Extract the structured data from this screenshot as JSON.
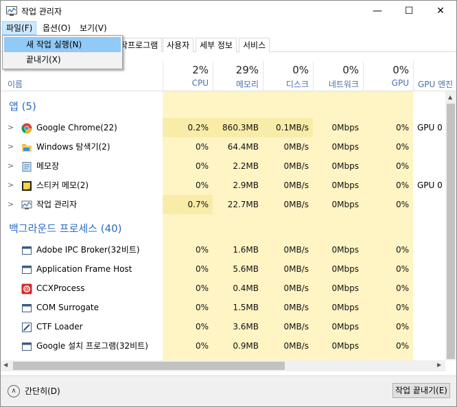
{
  "window": {
    "title": "작업 관리자",
    "controls": {
      "minimize": "—",
      "maximize": "☐",
      "close": "✕"
    }
  },
  "menubar": {
    "file": "파일(F)",
    "options": "옵션(O)",
    "view": "보기(V)"
  },
  "file_menu": {
    "items": [
      "새 작업 실행(N)",
      "끝내기(X)"
    ],
    "highlighted_index": 0
  },
  "tabs": [
    "작프로그램",
    "사용자",
    "세부 정보",
    "서비스"
  ],
  "header": {
    "name": "이름",
    "cpu": {
      "pct": "2%",
      "label": "CPU"
    },
    "mem": {
      "pct": "29%",
      "label": "메모리"
    },
    "disk": {
      "pct": "0%",
      "label": "디스크"
    },
    "net": {
      "pct": "0%",
      "label": "네트워크"
    },
    "gpu": {
      "pct": "0%",
      "label": "GPU"
    },
    "gpu_engine": {
      "label": "GPU 엔진"
    }
  },
  "groups": {
    "apps": "앱 (5)",
    "background": "백그라운드 프로세스 (40)"
  },
  "apps": [
    {
      "name": "Google Chrome(22)",
      "cpu": "0.2%",
      "mem": "860.3MB",
      "disk": "0.1MB/s",
      "net": "0Mbps",
      "gpu": "0%",
      "engine": "GPU 0 -"
    },
    {
      "name": "Windows 탐색기(2)",
      "cpu": "0%",
      "mem": "64.4MB",
      "disk": "0MB/s",
      "net": "0Mbps",
      "gpu": "0%",
      "engine": ""
    },
    {
      "name": "메모장",
      "cpu": "0%",
      "mem": "2.2MB",
      "disk": "0MB/s",
      "net": "0Mbps",
      "gpu": "0%",
      "engine": ""
    },
    {
      "name": "스티커 메모(2)",
      "cpu": "0%",
      "mem": "2.9MB",
      "disk": "0MB/s",
      "net": "0Mbps",
      "gpu": "0%",
      "engine": "GPU 0 -"
    },
    {
      "name": "작업 관리자",
      "cpu": "0.7%",
      "mem": "22.7MB",
      "disk": "0MB/s",
      "net": "0Mbps",
      "gpu": "0%",
      "engine": ""
    }
  ],
  "background": [
    {
      "name": "Adobe IPC Broker(32비트)",
      "cpu": "0%",
      "mem": "1.6MB",
      "disk": "0MB/s",
      "net": "0Mbps",
      "gpu": "0%"
    },
    {
      "name": "Application Frame Host",
      "cpu": "0%",
      "mem": "5.6MB",
      "disk": "0MB/s",
      "net": "0Mbps",
      "gpu": "0%"
    },
    {
      "name": "CCXProcess",
      "cpu": "0%",
      "mem": "0.4MB",
      "disk": "0MB/s",
      "net": "0Mbps",
      "gpu": "0%"
    },
    {
      "name": "COM Surrogate",
      "cpu": "0%",
      "mem": "1.5MB",
      "disk": "0MB/s",
      "net": "0Mbps",
      "gpu": "0%"
    },
    {
      "name": "CTF Loader",
      "cpu": "0%",
      "mem": "3.6MB",
      "disk": "0MB/s",
      "net": "0Mbps",
      "gpu": "0%"
    },
    {
      "name": "Google 설치 프로그램(32비트)",
      "cpu": "0%",
      "mem": "0.9MB",
      "disk": "0MB/s",
      "net": "0Mbps",
      "gpu": "0%"
    }
  ],
  "footer": {
    "fewer_details": "간단히(D)",
    "end_task": "작업 끝내기(E)"
  },
  "colors": {
    "accent": "#2b6cc4",
    "heat_light": "#fff4c4",
    "heat_strong": "#f9eca8",
    "menu_highlight": "#91c9f7"
  }
}
